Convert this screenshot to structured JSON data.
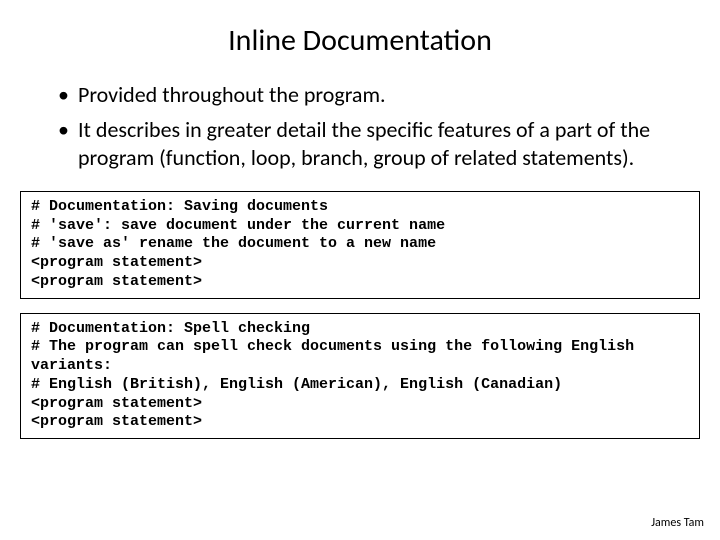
{
  "title": "Inline Documentation",
  "bullets": [
    "Provided throughout the program.",
    "It describes in greater detail the specific features of a part of the program (function, loop, branch, group of related statements)."
  ],
  "code_blocks": [
    "# Documentation: Saving documents\n# 'save': save document under the current name\n# 'save as' rename the document to a new name\n<program statement>\n<program statement>",
    "# Documentation: Spell checking\n# The program can spell check documents using the following English variants:\n# English (British), English (American), English (Canadian)\n<program statement>\n<program statement>"
  ],
  "footer": "James Tam"
}
